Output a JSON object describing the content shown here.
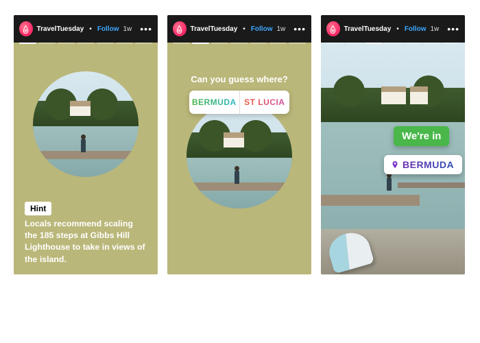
{
  "header": {
    "username": "TravelTuesday",
    "follow_label": "Follow",
    "separator": "•",
    "timestamp": "1w",
    "more": "•••"
  },
  "story1": {
    "hint_label": "Hint",
    "hint_body": "Locals recommend scaling the 185 steps at Gibbs Hill Lighthouse to take in views of the island."
  },
  "story2": {
    "question": "Can you guess where?",
    "poll": {
      "option_a": "BERMUDA",
      "option_b": "ST LUCIA"
    }
  },
  "story3": {
    "reveal": "We're in",
    "location": "BERMUDA"
  },
  "icons": {
    "avatar": "airbnb-logo-icon",
    "more": "more-horizontal-icon",
    "pin": "location-pin-icon"
  }
}
